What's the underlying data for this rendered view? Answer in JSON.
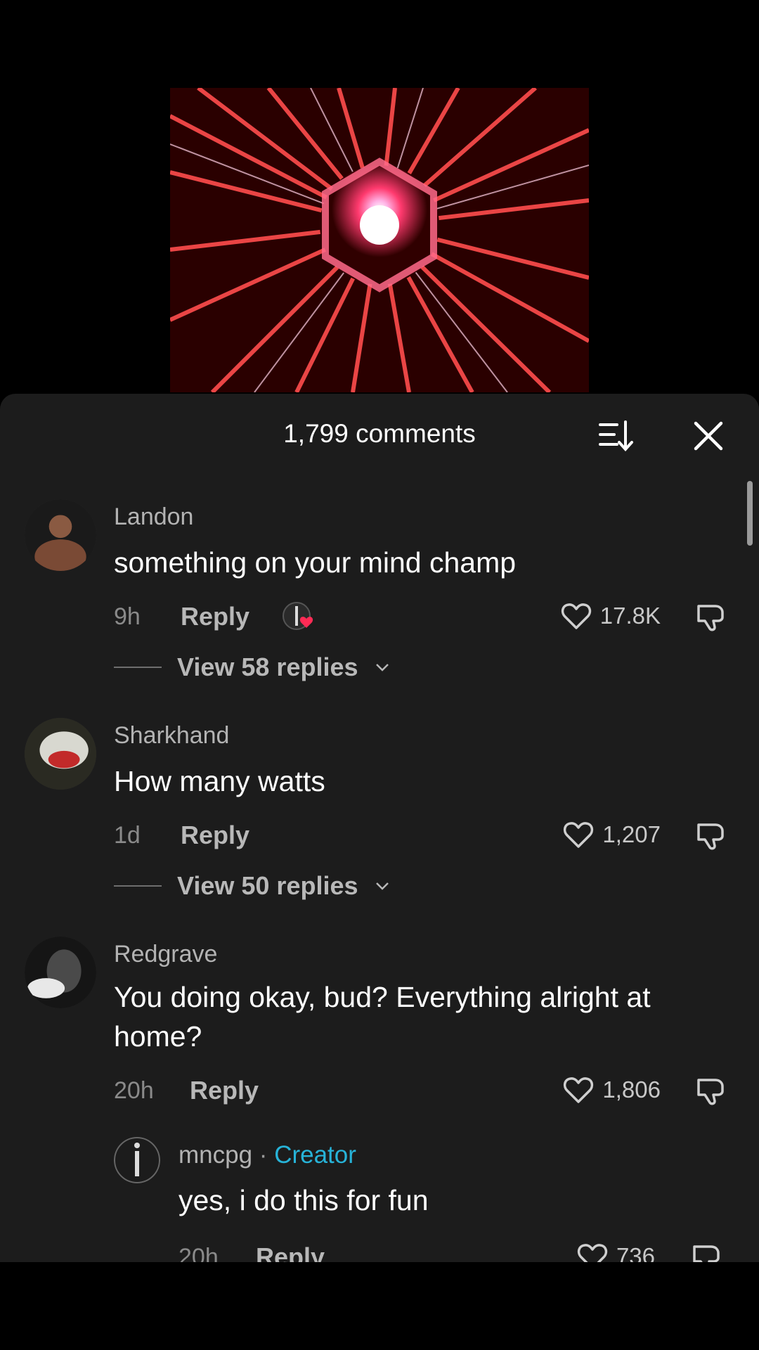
{
  "header": {
    "title": "1,799 comments"
  },
  "comments": [
    {
      "user": "Landon",
      "text": "something on your mind champ",
      "time": "9h",
      "reply_label": "Reply",
      "likes": "17.8K",
      "creator_liked": true,
      "replies_label": "View 58 replies"
    },
    {
      "user": "Sharkhand",
      "text": "How many watts",
      "time": "1d",
      "reply_label": "Reply",
      "likes": "1,207",
      "replies_label": "View 50 replies"
    },
    {
      "user": "Redgrave",
      "text": "You doing okay, bud? Everything alright at home?",
      "time": "20h",
      "reply_label": "Reply",
      "likes": "1,806"
    }
  ],
  "reply": {
    "user": "mncpg",
    "separator": "·",
    "badge": "Creator",
    "text": "yes, i do this for fun",
    "time": "20h",
    "reply_label": "Reply",
    "likes": "736"
  },
  "colors": {
    "creator": "#27b3d8",
    "heart": "#ff2b55"
  }
}
